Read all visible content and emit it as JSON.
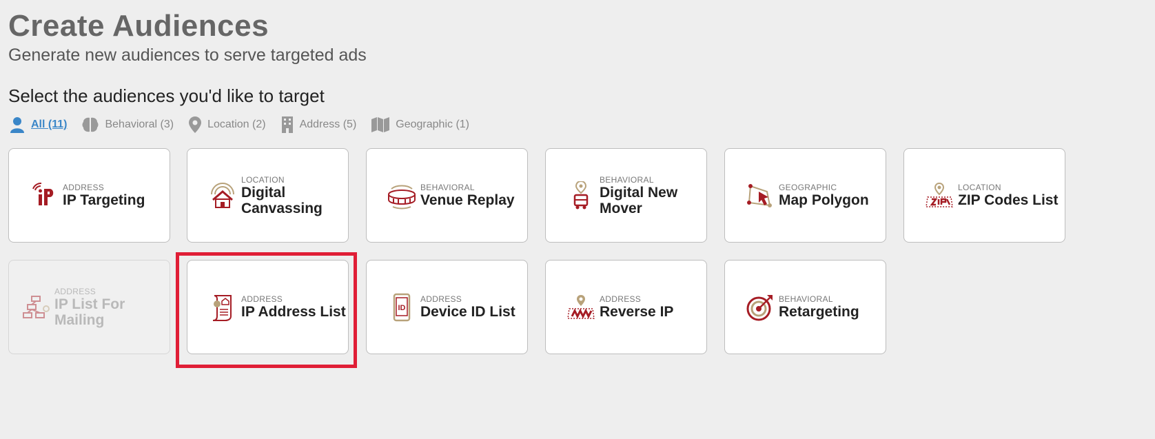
{
  "header": {
    "title": "Create Audiences",
    "subtitle": "Generate new audiences to serve targeted ads",
    "section_title": "Select the audiences you'd like to target"
  },
  "filters": [
    {
      "label": "All (11)",
      "icon": "person-icon",
      "active": true
    },
    {
      "label": "Behavioral (3)",
      "icon": "brain-icon",
      "active": false
    },
    {
      "label": "Location (2)",
      "icon": "map-pin-icon",
      "active": false
    },
    {
      "label": "Address (5)",
      "icon": "building-icon",
      "active": false
    },
    {
      "label": "Geographic (1)",
      "icon": "folded-map-icon",
      "active": false
    }
  ],
  "cards": [
    {
      "category": "ADDRESS",
      "name": "IP Targeting",
      "icon": "ip-targeting-icon",
      "disabled": false
    },
    {
      "category": "LOCATION",
      "name": "Digital Canvassing",
      "icon": "house-signal-icon",
      "disabled": false
    },
    {
      "category": "BEHAVIORAL",
      "name": "Venue Replay",
      "icon": "stadium-icon",
      "disabled": false
    },
    {
      "category": "BEHAVIORAL",
      "name": "Digital New Mover",
      "icon": "moving-truck-icon",
      "disabled": false
    },
    {
      "category": "GEOGRAPHIC",
      "name": "Map Polygon",
      "icon": "polygon-pointer-icon",
      "disabled": false
    },
    {
      "category": "LOCATION",
      "name": "ZIP Codes List",
      "icon": "zip-map-icon",
      "disabled": false
    },
    {
      "category": "ADDRESS",
      "name": "IP List For Mailing",
      "icon": "network-tree-icon",
      "disabled": true
    },
    {
      "category": "ADDRESS",
      "name": "IP Address List",
      "icon": "scroll-list-icon",
      "disabled": false,
      "selected": true
    },
    {
      "category": "ADDRESS",
      "name": "Device ID List",
      "icon": "phone-id-icon",
      "disabled": false
    },
    {
      "category": "ADDRESS",
      "name": "Reverse IP",
      "icon": "map-pin-grid-icon",
      "disabled": false
    },
    {
      "category": "BEHAVIORAL",
      "name": "Retargeting",
      "icon": "target-arrow-icon",
      "disabled": false
    }
  ],
  "colors": {
    "brand_red": "#a51c24",
    "brand_gold": "#b8a27a",
    "active_link": "#3a86c8",
    "highlight": "#e01e36"
  }
}
